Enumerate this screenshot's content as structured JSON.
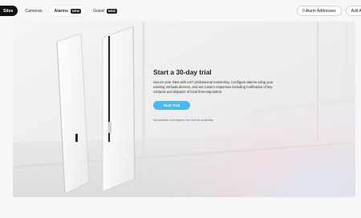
{
  "tabs": [
    {
      "label": "Sites",
      "state": "active-dark"
    },
    {
      "label": "Cameras",
      "state": "normal"
    },
    {
      "label": "Alarms",
      "state": "active-light",
      "badge": "NEW"
    },
    {
      "label": "Guest",
      "state": "normal",
      "badge": "NEW"
    }
  ],
  "header_actions": {
    "addresses_label": "0 Alarm Addresses",
    "add_label": "Add A"
  },
  "promo": {
    "title": "Start a 30-day trial",
    "description": "Secure your sites with 24/7 professional monitoring. Configure alarms using your existing Verkada devices, and set custom responses including notification of key contacts and dispatch of local first-responders.",
    "button_label": "Start Trial",
    "note_prefix": "Not available in all regions. See ",
    "note_link": "here",
    "note_suffix": " for availability."
  },
  "colors": {
    "accent": "#49b9ee",
    "dark": "#111111",
    "link": "#2f7fd6"
  }
}
